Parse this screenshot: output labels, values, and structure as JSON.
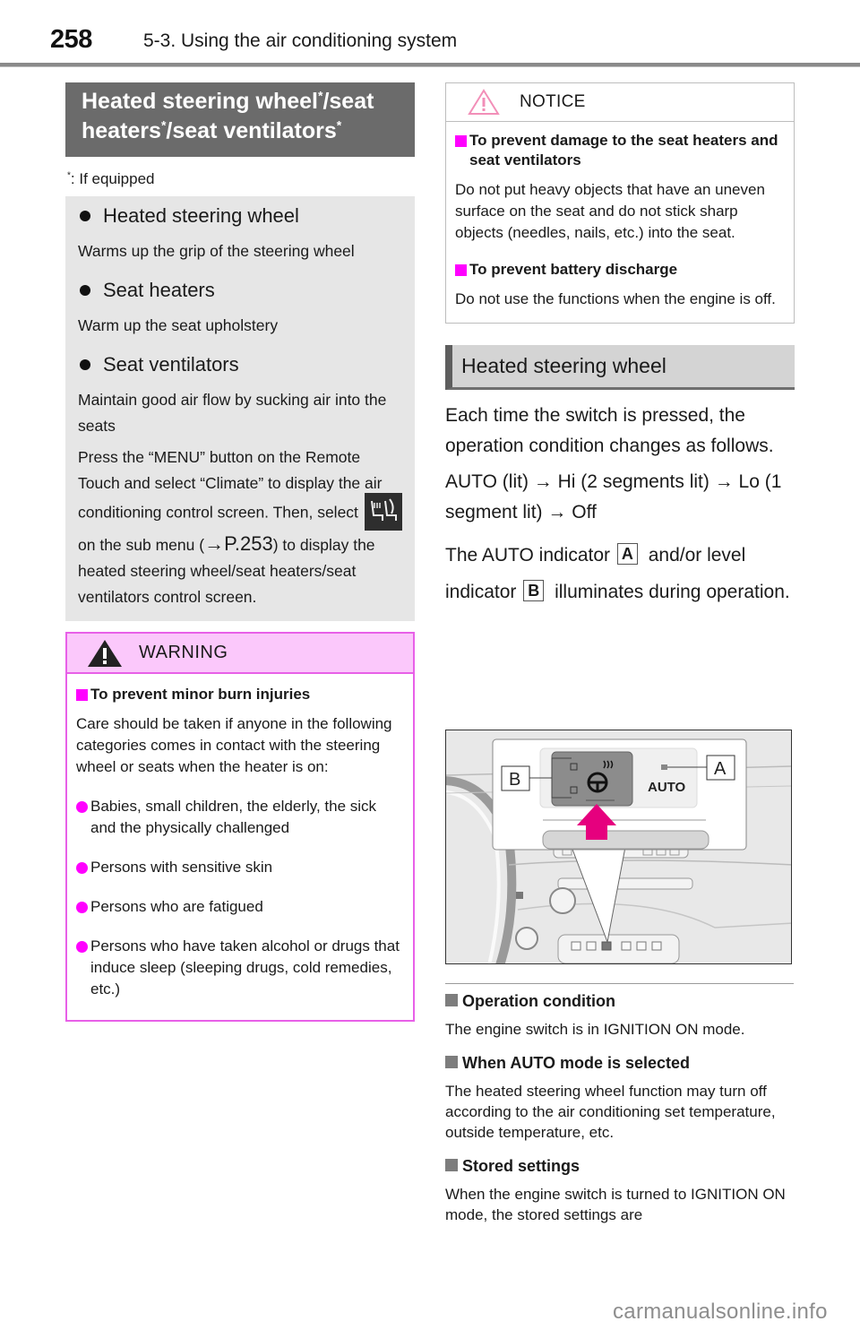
{
  "header": {
    "page_number": "258",
    "section_title": "5-3. Using the air conditioning system"
  },
  "left": {
    "main_heading": {
      "part1": "Heated steering wheel",
      "part2": "/seat",
      "part3": "heaters",
      "part4": "/seat ventilators",
      "asterisk": "*"
    },
    "footnote": {
      "marker": "*",
      "text": ":  If equipped"
    },
    "features": [
      {
        "title": "Heated steering wheel",
        "description": "Warms up the grip of the steering wheel"
      },
      {
        "title": "Seat heaters",
        "description": "Warm up the seat upholstery"
      },
      {
        "title": "Seat ventilators",
        "description": "Maintain good air flow by sucking air into the seats"
      }
    ],
    "instructions": {
      "before_icon": "Press the “MENU” button on the Remote Touch and select “Climate” to display the air conditioning control screen. Then, select",
      "icon": "seat-climate-icon",
      "after_icon": " on the sub menu (",
      "arrow": "→",
      "page_ref": "P.253",
      "after_ref": ") to display the heated steering wheel/seat heaters/seat ventilators control screen."
    },
    "warning": {
      "label": "WARNING",
      "subheading": "To prevent minor burn injuries",
      "body": "Care should be taken if anyone in the following categories comes in contact with the steering wheel or seats when the heater is on:",
      "items": [
        "Babies, small children, the elderly, the sick and the physically challenged",
        "Persons with sensitive skin",
        "Persons who are fatigued",
        "Persons who have taken alcohol or drugs that induce sleep (sleeping drugs, cold remedies, etc.)"
      ]
    }
  },
  "right": {
    "notice": {
      "label": "NOTICE",
      "sections": [
        {
          "subheading": "To prevent damage to the seat heaters and seat ventilators",
          "body": "Do not put heavy objects that have an uneven surface on the seat and do not stick sharp objects (needles, nails, etc.) into the seat."
        },
        {
          "subheading": "To prevent battery discharge",
          "body": "Do not use the functions when the engine is off."
        }
      ]
    },
    "section_heading": "Heated steering wheel",
    "intro": "Each time the switch is pressed, the operation condition changes as follows.",
    "sequence": {
      "s1": "AUTO (lit)",
      "s2": "Hi (2 segments lit)",
      "s3": "Lo (1 segment lit)",
      "s4": "Off",
      "arrow": "→"
    },
    "indicator_text": {
      "part1": "The AUTO indicator",
      "marker_a": "A",
      "part2": " and/or level indicator",
      "marker_b": "B",
      "part3": " illuminates during operation."
    },
    "figure": {
      "label_a": "A",
      "label_b": "B",
      "auto_text": "AUTO",
      "highlight_color": "#e6007e"
    },
    "notes": [
      {
        "heading": "Operation condition",
        "text": "The engine switch is in IGNITION ON mode."
      },
      {
        "heading": "When AUTO mode is selected",
        "text": "The heated steering wheel function may turn off according to the air conditioning set temperature, outside temperature, etc."
      },
      {
        "heading": "Stored settings",
        "text": "When the engine switch is turned to IGNITION ON mode, the stored settings are"
      }
    ]
  },
  "watermark": "carmanualsonline.info",
  "colors": {
    "warning_accent": "#ff00ff",
    "warning_header_bg": "#fbc8fb",
    "heading_bg": "#6b6b6b"
  }
}
